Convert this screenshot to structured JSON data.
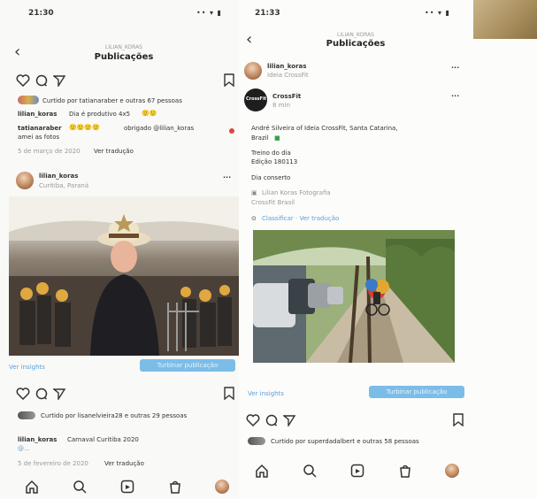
{
  "left": {
    "time": "21:30",
    "signals": "•• ▾ ▮",
    "subtitle": "LILIAN_KORAS",
    "title": "Publicações",
    "liked_by": "Curtido por tatianaraber e outras 67 pessoas",
    "caption_user": "lilian_koras",
    "caption": "Dia é produtivo 4x5 ",
    "comment_user": "tatianaraber",
    "comment_text": "obrigado @lilian_koras",
    "comment_text2": "amei as fotos",
    "meta_date": "5 de março de 2020",
    "meta_translate": "Ver tradução",
    "post2_user": "lilian_koras",
    "post2_location": "Curitiba, Paraná",
    "insights": "Ver insights",
    "promote": "Turbinar publicação",
    "liked_by2": "Curtido por lisanelvieira28 e outras 29 pessoas",
    "caption2_user": "lilian_koras",
    "caption2": "Carnaval Curitiba 2020",
    "caption2_more": "@...",
    "meta2_date": "5 de fevereiro de 2020",
    "meta2_translate": "Ver tradução"
  },
  "right": {
    "time": "21:33",
    "signals": "•• ▾ ▮",
    "subtitle": "LILIAN_KORAS",
    "title": "Publicações",
    "shared_user": "lilian_koras",
    "shared_sub": "Ideia CrossFit",
    "post_user": "CrossFit",
    "post_badge": "CrossFit",
    "post_time": "8 min",
    "line1": "André Silveira of Ideia CrossFit, Santa Catarina,",
    "line2": "Brazil",
    "line3": "Treino do dia",
    "line4": "Edição 180113",
    "line5": "Dia conserto",
    "line6": "Lilian Koras Fotografia",
    "line7": "CrossFit Brasil",
    "line8": "Classificar · Ver tradução",
    "insights": "Ver insights",
    "promote": "Turbinar publicação",
    "liked_by": "Curtido por superdadalbert e outras 58 pessoas"
  },
  "colors": {
    "accent_blue": "#7cbde8",
    "heart_red": "#e0453a",
    "bg": "#f9f9f7"
  }
}
